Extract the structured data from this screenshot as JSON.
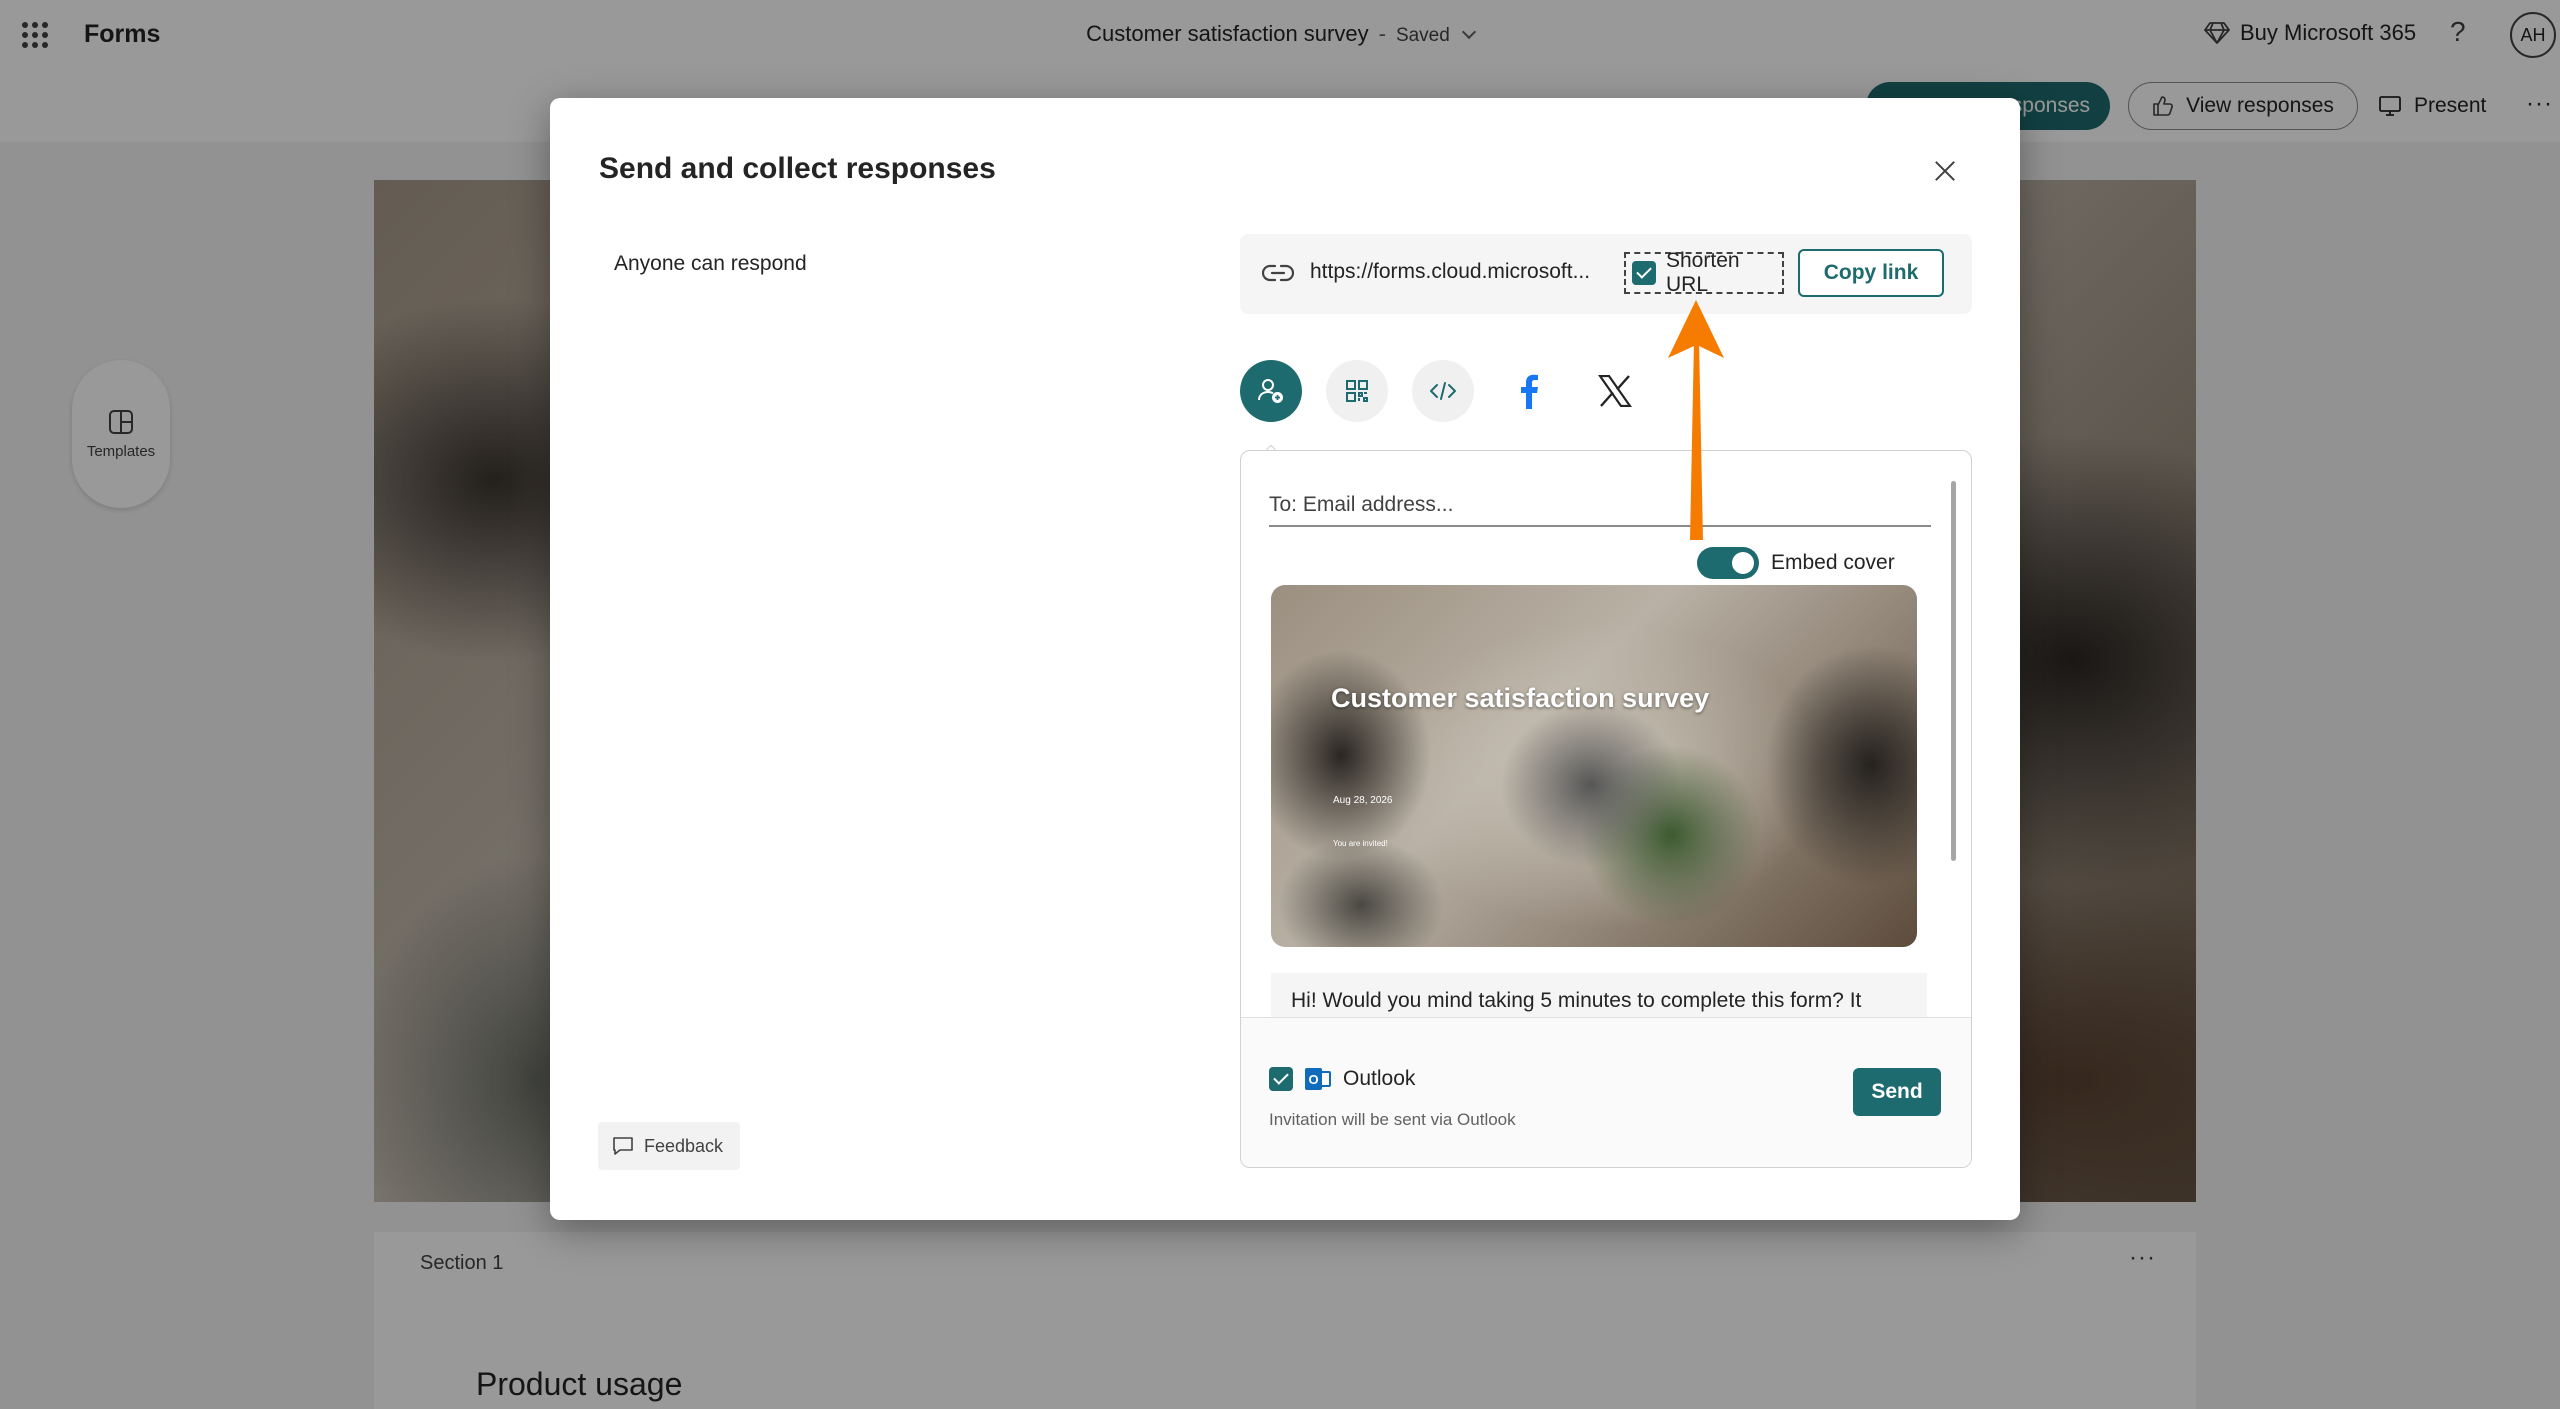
{
  "app": {
    "name": "Forms",
    "doc_title": "Customer satisfaction survey",
    "separator": "-",
    "saved_status": "Saved",
    "buy_label": "Buy Microsoft 365",
    "help_label": "?",
    "avatar_initials": "AH"
  },
  "toolbar": {
    "collect_label": "Collect responses",
    "collect_visible": "sponses",
    "view_label": "View responses",
    "present_label": "Present",
    "more_label": "···"
  },
  "sidebar": {
    "templates_label": "Templates"
  },
  "form": {
    "section_label": "Section 1",
    "section_more": "···",
    "question_title": "Product usage"
  },
  "dialog": {
    "title": "Send and collect responses",
    "permission": "Anyone can respond",
    "url": "https://forms.cloud.microsoft...",
    "shorten_label": "Shorten URL",
    "shorten_checked": true,
    "copy_label": "Copy link",
    "share_options": [
      {
        "icon": "people-invite-icon",
        "active": true
      },
      {
        "icon": "qr-code-icon",
        "active": false
      },
      {
        "icon": "embed-code-icon",
        "active": false
      },
      {
        "icon": "facebook-icon",
        "active": false
      },
      {
        "icon": "x-twitter-icon",
        "active": false
      }
    ],
    "email": {
      "placeholder": "To: Email address...",
      "embed_cover_label": "Embed cover",
      "embed_cover_on": true,
      "preview": {
        "title": "Customer satisfaction survey",
        "date": "Aug 28, 2026",
        "invite": "You are invited!"
      },
      "message": "Hi! Would you mind taking 5 minutes to complete this form? It",
      "outlook_label": "Outlook",
      "outlook_checked": true,
      "outlook_note": "Invitation will be sent via Outlook",
      "send_label": "Send"
    },
    "feedback_label": "Feedback"
  },
  "colors": {
    "accent": "#1e6b6f",
    "annotation": "#f57c00",
    "outlook_blue": "#0f6cbd"
  }
}
